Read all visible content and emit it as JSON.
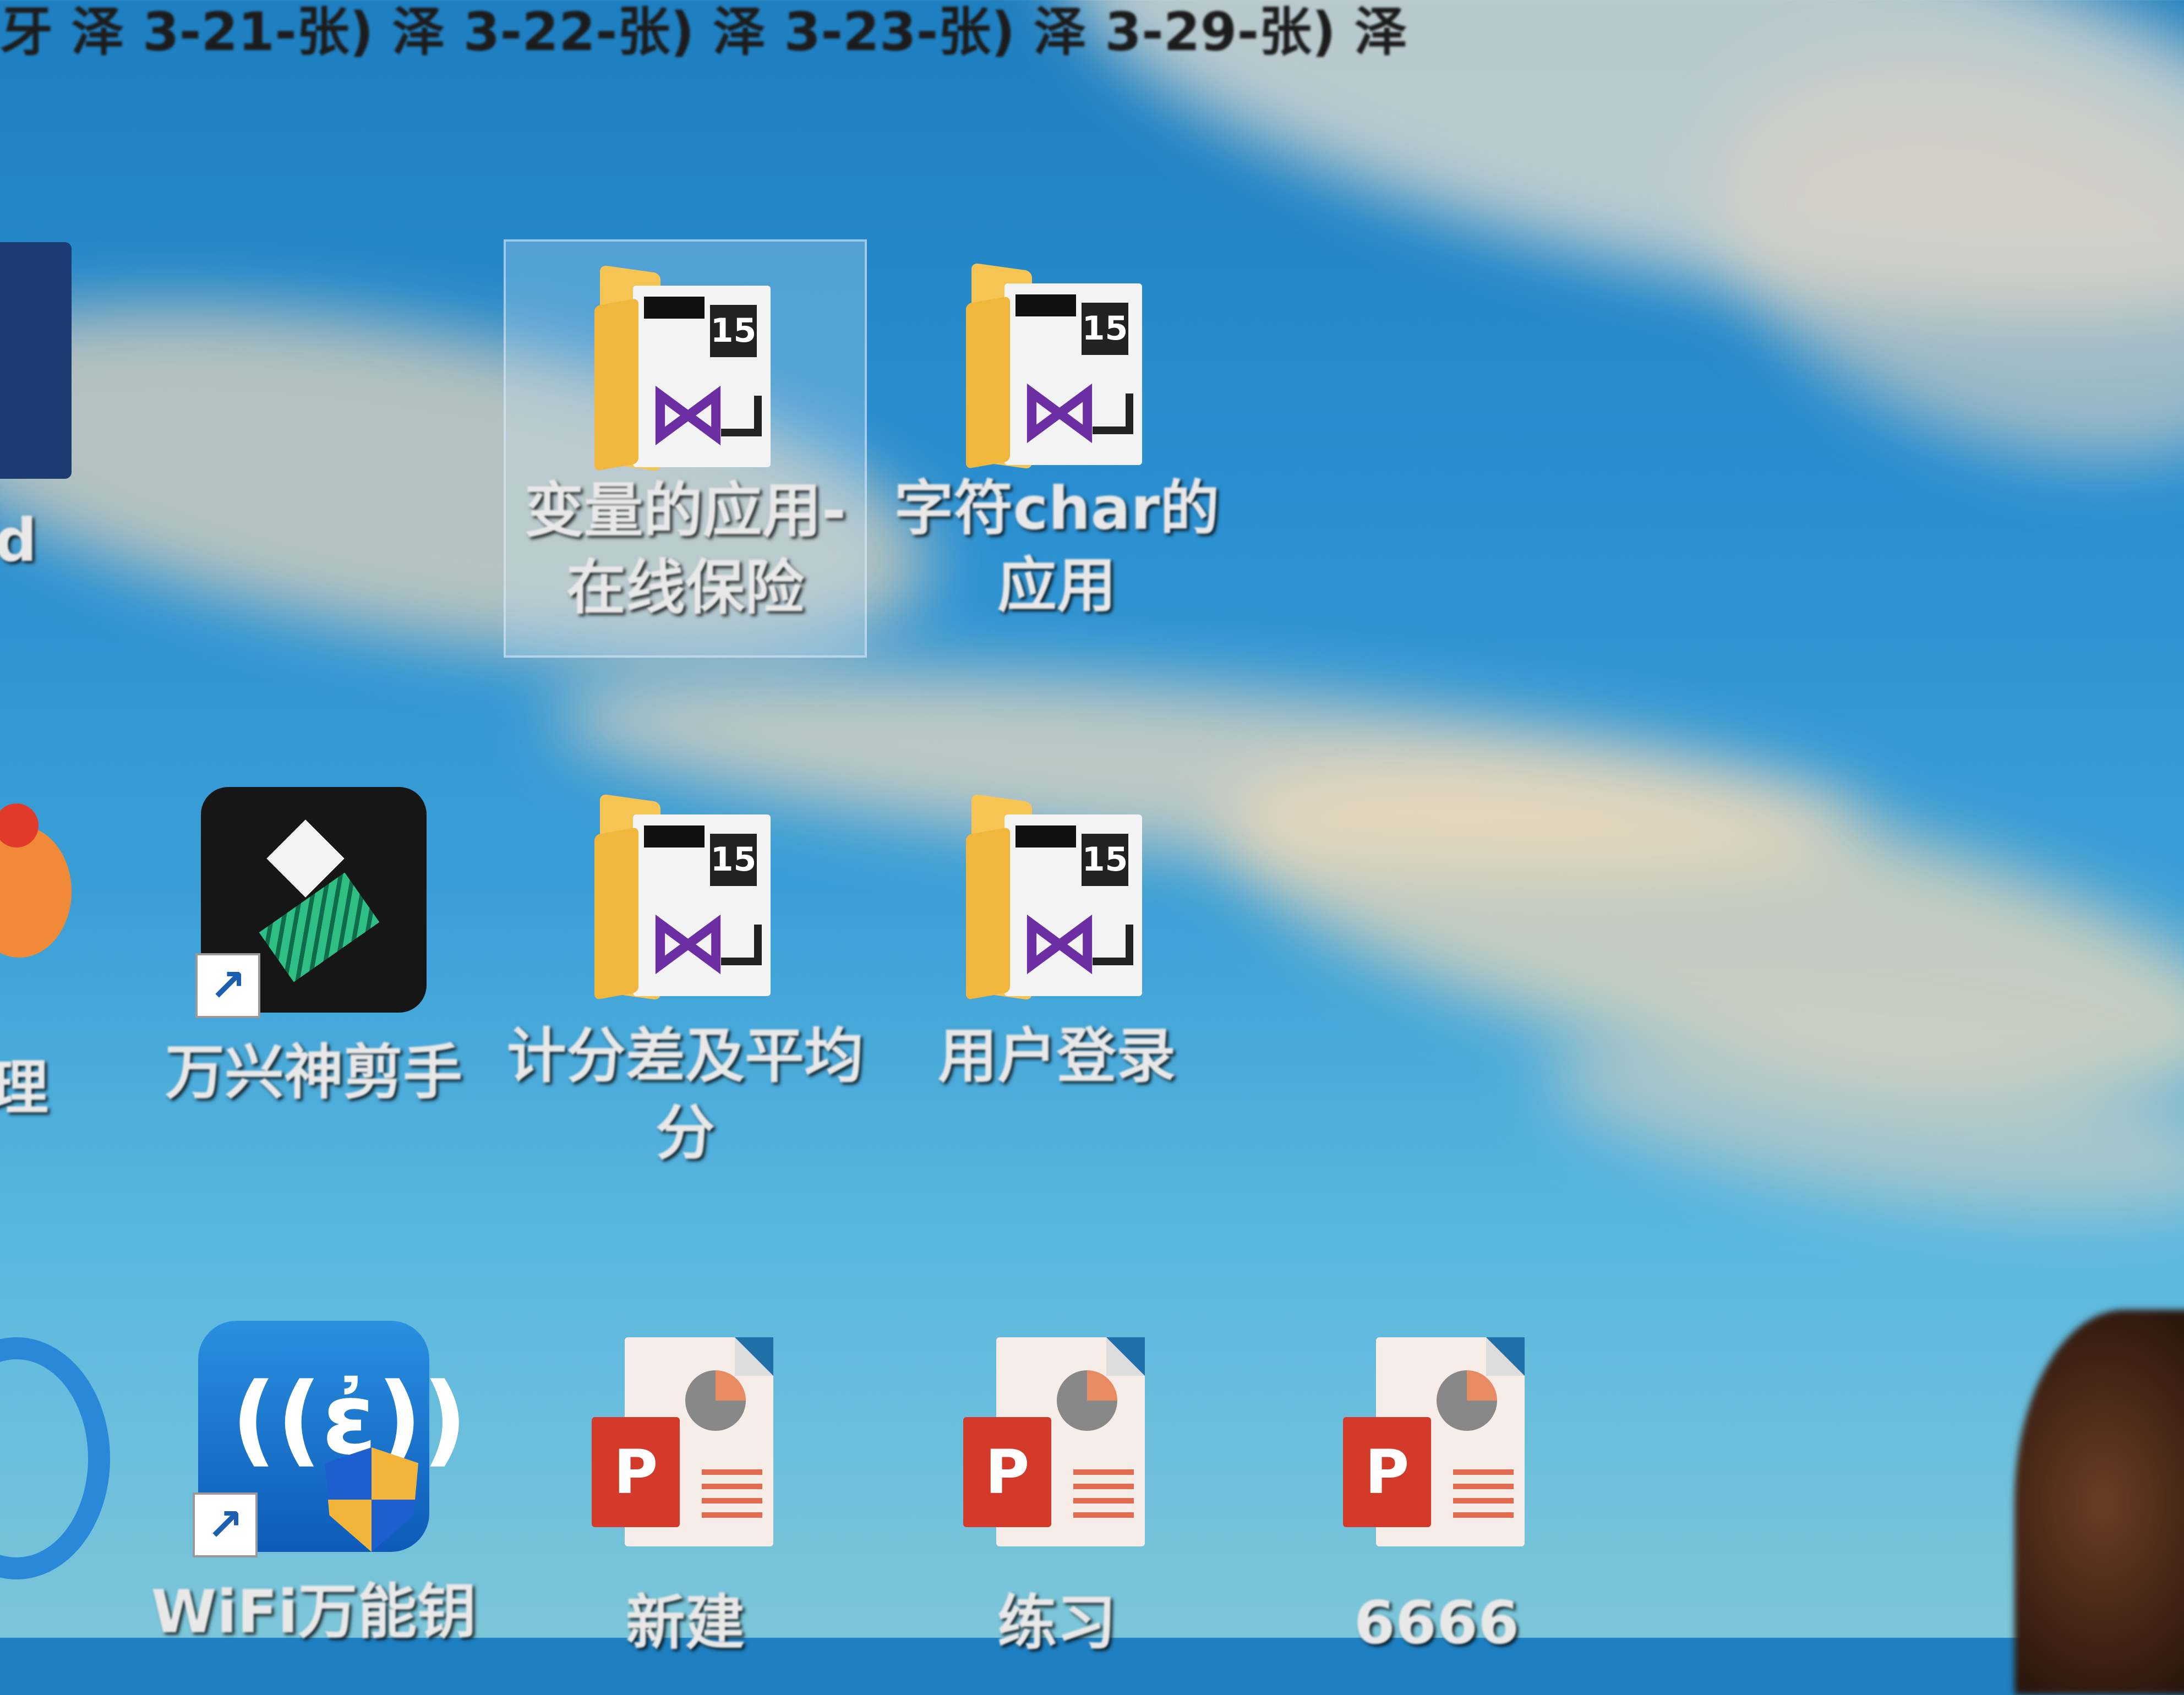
{
  "taskbar_strip": {
    "text": "牙 泽 3-21-张) 泽 3-22-张) 泽 3-23-张) 泽 3-29-张) 泽"
  },
  "partial_icons": {
    "left_top_label": "d",
    "left_middle_label": "理"
  },
  "icons": [
    {
      "label": "变量的应用-\n在线保险",
      "type": "vs-solution-folder",
      "badge": "15",
      "selected": true
    },
    {
      "label": "字符char的\n应用",
      "type": "vs-solution-folder",
      "badge": "15",
      "selected": false
    },
    {
      "label": "万兴神剪手",
      "type": "app-shortcut",
      "icon": "filmora-icon",
      "selected": false
    },
    {
      "label": "计分差及平均\n分",
      "type": "vs-solution-folder",
      "badge": "15",
      "selected": false
    },
    {
      "label": "用户登录",
      "type": "vs-solution-folder",
      "badge": "15",
      "selected": false
    },
    {
      "label": "WiFi万能钥",
      "type": "app-shortcut",
      "icon": "wifi-master-key-icon",
      "selected": false
    },
    {
      "label": "新建",
      "type": "powerpoint-file",
      "selected": false
    },
    {
      "label": "练习",
      "type": "powerpoint-file",
      "selected": false
    },
    {
      "label": "6666",
      "type": "powerpoint-file",
      "selected": false
    }
  ],
  "glyphs": {
    "powerpoint_letter": "P",
    "vs_logo": "⋈",
    "shortcut_arrow": "↗",
    "wifi_waves": "((ἐ))"
  },
  "colors": {
    "folder": "#f6c453",
    "vs_purple": "#6b2fa3",
    "ppt_red": "#d33a2a",
    "filmora_green": "#2fbf86",
    "wifi_blue": "#1e7fd8"
  }
}
